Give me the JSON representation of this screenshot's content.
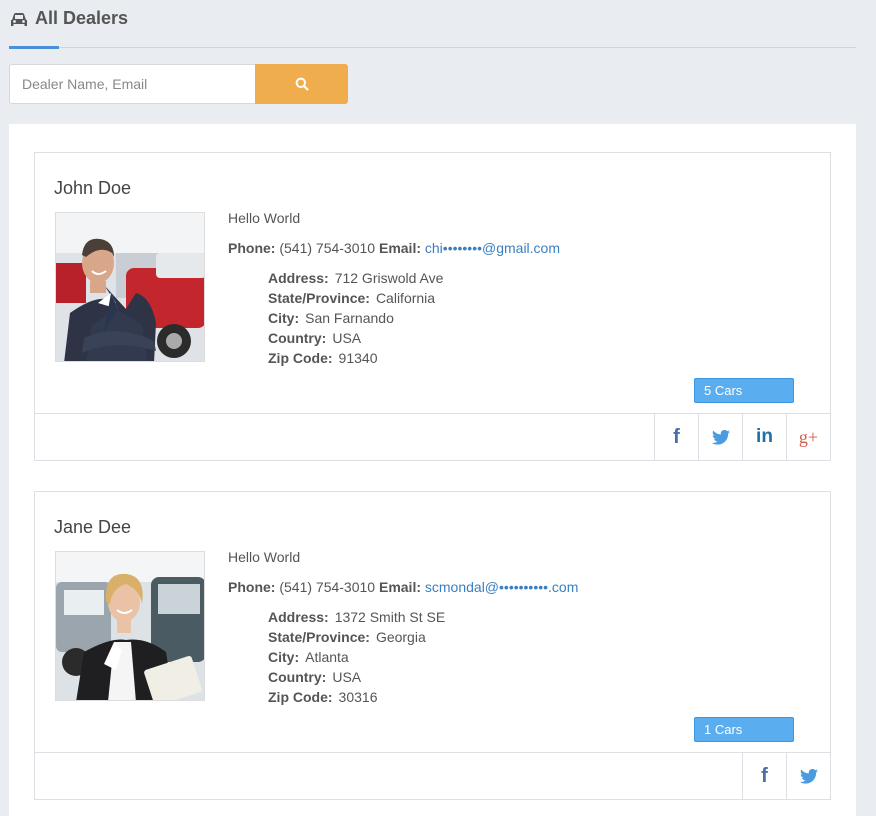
{
  "header": {
    "title": "All Dealers",
    "icon": "car-icon"
  },
  "search": {
    "placeholder": "Dealer Name, Email",
    "button_icon": "search-icon",
    "button_color": "#f0ad4e"
  },
  "dealers": [
    {
      "name": "John Doe",
      "bio": "Hello World",
      "phone_label": "Phone:",
      "phone": "(541) 754-3010",
      "email_label": "Email:",
      "email": "chi••••••••@gmail.com",
      "address_label": "Address:",
      "address": "712 Griswold Ave",
      "state_label": "State/Province:",
      "state": "California",
      "city_label": "City:",
      "city": "San Farnando",
      "country_label": "Country:",
      "country": "USA",
      "zip_label": "Zip Code:",
      "zip": "91340",
      "cars": "5 Cars",
      "social": [
        "facebook-icon",
        "twitter-icon",
        "linkedin-icon",
        "google-plus-icon"
      ]
    },
    {
      "name": "Jane Dee",
      "bio": "Hello World",
      "phone_label": "Phone:",
      "phone": "(541) 754-3010",
      "email_label": "Email:",
      "email": "scmondal@••••••••••.com",
      "address_label": "Address:",
      "address": "1372 Smith St SE",
      "state_label": "State/Province:",
      "state": "Georgia",
      "city_label": "City:",
      "city": "Atlanta",
      "country_label": "Country:",
      "country": "USA",
      "zip_label": "Zip Code:",
      "zip": "30316",
      "cars": "1 Cars",
      "social": [
        "facebook-icon",
        "twitter-icon"
      ]
    }
  ],
  "colors": {
    "accent": "#4a90d9",
    "badge": "#5aaef0",
    "link": "#3a7fc1"
  }
}
